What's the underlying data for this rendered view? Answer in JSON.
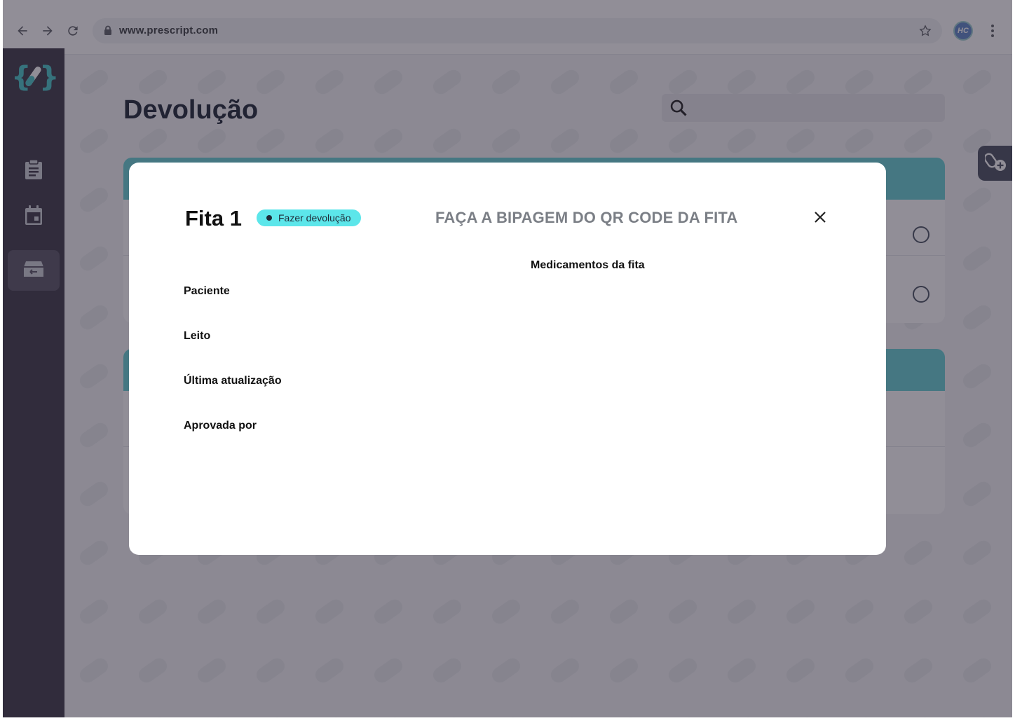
{
  "browser": {
    "url": "www.prescript.com",
    "avatar_initials": "HC"
  },
  "page": {
    "title": "Devolução",
    "search": {
      "placeholder": ""
    }
  },
  "modal": {
    "title": "Fita 1",
    "badge": "Fazer devolução",
    "qr_heading": "FAÇA A BIPAGEM DO QR CODE DA FITA",
    "medications_label": "Medicamentos da fita",
    "fields": {
      "patient": "Paciente",
      "bed": "Leito",
      "last_update": "Última atualização",
      "approved_by": "Aprovada por"
    }
  },
  "colors": {
    "accent_teal": "#66d1d4",
    "badge_teal": "#5ce6ea",
    "sidebar": "#3f3b48",
    "overlay": "rgba(36,30,48,0.5)"
  },
  "icons": {
    "sidebar": [
      "clipboard-icon",
      "calendar-icon",
      "return-box-icon"
    ],
    "fab": "add-pills-icon"
  }
}
